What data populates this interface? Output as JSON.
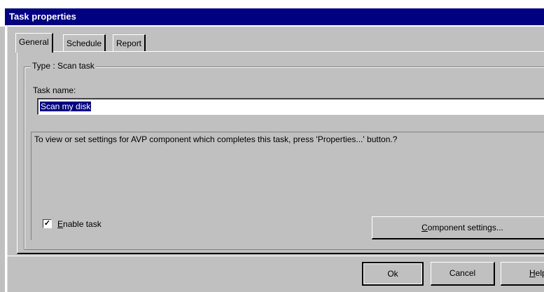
{
  "window": {
    "title": "Task properties"
  },
  "tabs": [
    {
      "label": "General",
      "active": true
    },
    {
      "label": "Schedule",
      "active": false
    },
    {
      "label": "Report",
      "active": false
    }
  ],
  "group": {
    "legend": "Type : Scan task"
  },
  "task_name": {
    "label": "Task name:",
    "value": "Scan my disk"
  },
  "info_text": "To view or set settings for AVP component which completes this task, press 'Properties...' button.?",
  "enable_task": {
    "mnemonic": "E",
    "label_rest": "nable task",
    "checked": true
  },
  "component_button": {
    "mnemonic": "C",
    "label_rest": "omponent settings..."
  },
  "buttons": {
    "ok": "Ok",
    "cancel": "Cancel",
    "help_mnemonic": "H",
    "help_rest": "elp"
  },
  "colors": {
    "titlebar": "#000080",
    "face": "#c0c0c0"
  }
}
